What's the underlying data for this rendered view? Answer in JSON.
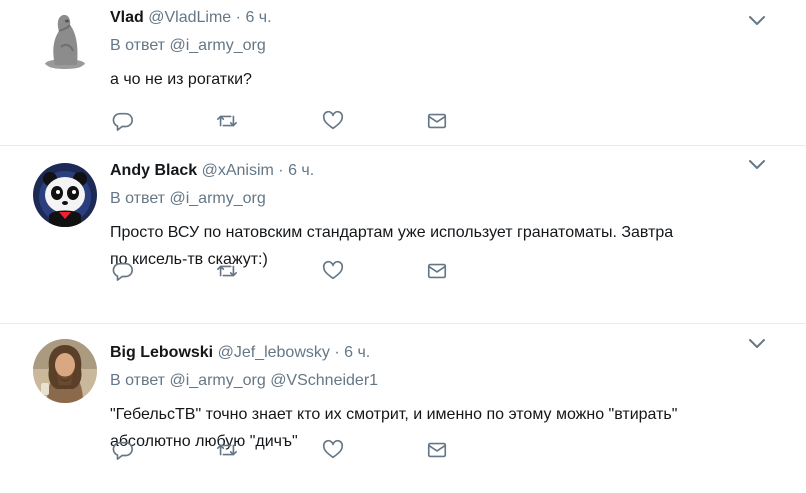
{
  "colors": {
    "text": "#14171a",
    "secondary": "#657786",
    "border": "#e6ecf0",
    "icon": "#657786"
  },
  "tweets": [
    {
      "name": "Vlad",
      "handle": "@VladLime",
      "dot": "·",
      "time": "6 ч.",
      "reply_label": "В ответ",
      "reply_mentions": "@i_army_org",
      "text": [
        "а чо не из рогатки?"
      ],
      "avatar": "stone-figure-avatar"
    },
    {
      "name": "Andy Black",
      "handle": "@xAnisim",
      "dot": "·",
      "time": "6 ч.",
      "reply_label": "В ответ",
      "reply_mentions": "@i_army_org",
      "text": [
        "Просто ВСУ по натовским стандартам уже использует гранатоматы. Завтра",
        "по кисель-тв скажут:)"
      ],
      "avatar": "panda-avatar"
    },
    {
      "name": "Big Lebowski",
      "handle": "@Jef_lebowsky",
      "dot": "·",
      "time": "6 ч.",
      "reply_label": "В ответ",
      "reply_mentions": "@i_army_org @VSchneider1",
      "text": [
        "\"ГебельсТВ\" точно знает кто их смотрит, и именно по этому можно \"втирать\"",
        "абсолютно любую \"дичъ\""
      ],
      "avatar": "bearded-man-avatar"
    }
  ],
  "icons": [
    "reply-icon",
    "retweet-icon",
    "like-icon",
    "direct-message-icon",
    "chevron-down-icon"
  ]
}
